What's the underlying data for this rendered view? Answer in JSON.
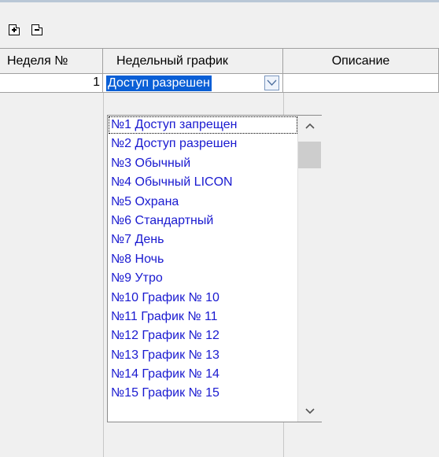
{
  "toolbar": {
    "add_icon": "add-row-icon",
    "remove_icon": "remove-row-icon"
  },
  "grid": {
    "columns": [
      "Неделя №",
      "Недельный график",
      "Описание"
    ],
    "rows": [
      {
        "week": "1",
        "schedule": "Доступ разрешен",
        "description": ""
      }
    ]
  },
  "dropdown": {
    "items": [
      "№1 Доступ запрещен",
      "№2 Доступ разрешен",
      "№3 Обычный",
      "№4 Обычный LICON",
      "№5 Охрана",
      "№6 Стандартный",
      "№7 День",
      "№8 Ночь",
      "№9 Утро",
      "№10 График  №  10",
      "№11 График  №  11",
      "№12 График  №  12",
      "№13 График  №  13",
      "№14 График  №  14",
      "№15 График  №  15"
    ],
    "focused_index": 0
  },
  "colors": {
    "item_text": "#1a1ad0",
    "selection": "#0a5fd6",
    "grid_line": "#a0a0a0"
  }
}
